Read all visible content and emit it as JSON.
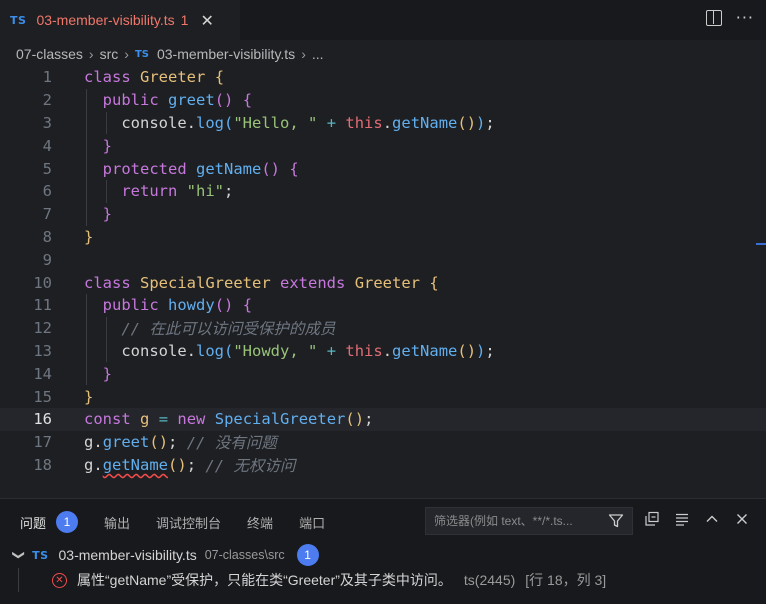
{
  "tab": {
    "lang": "TS",
    "title": "03-member-visibility.ts",
    "count": "1",
    "close": "✕"
  },
  "tab_actions": {
    "split_icon": "split-editor-icon",
    "more": "···"
  },
  "breadcrumb": {
    "folder": "07-classes",
    "sub": "src",
    "lang": "TS",
    "file": "03-member-visibility.ts",
    "ellipsis": "..."
  },
  "code_lines": [
    {
      "n": "1"
    },
    {
      "n": "2"
    },
    {
      "n": "3"
    },
    {
      "n": "4"
    },
    {
      "n": "5"
    },
    {
      "n": "6"
    },
    {
      "n": "7"
    },
    {
      "n": "8"
    },
    {
      "n": "9"
    },
    {
      "n": "10"
    },
    {
      "n": "11"
    },
    {
      "n": "12"
    },
    {
      "n": "13"
    },
    {
      "n": "14"
    },
    {
      "n": "15"
    },
    {
      "n": "16"
    },
    {
      "n": "17"
    },
    {
      "n": "18"
    }
  ],
  "code": {
    "l1": {
      "kw": "class",
      "name": "Greeter",
      "brace": "{"
    },
    "l2": {
      "kw": "public",
      "fn": "greet",
      "parens": "()",
      "brace": "{"
    },
    "l3": {
      "obj": "console",
      "dot": ".",
      "fn": "log",
      "open": "(",
      "str": "\"Hello, \"",
      "op": "+",
      "this": "this",
      "dot2": ".",
      "fn2": "getName",
      "call": "()",
      "close": ")",
      "semi": ";"
    },
    "l4": {
      "brace": "}"
    },
    "l5": {
      "kw": "protected",
      "fn": "getName",
      "parens": "()",
      "brace": "{"
    },
    "l6": {
      "kw": "return",
      "str": "\"hi\"",
      "semi": ";"
    },
    "l7": {
      "brace": "}"
    },
    "l8": {
      "brace": "}"
    },
    "l10": {
      "kw": "class",
      "name": "SpecialGreeter",
      "kw2": "extends",
      "base": "Greeter",
      "brace": "{"
    },
    "l11": {
      "kw": "public",
      "fn": "howdy",
      "parens": "()",
      "brace": "{"
    },
    "l12": {
      "comment": "// 在此可以访问受保护的成员"
    },
    "l13": {
      "obj": "console",
      "dot": ".",
      "fn": "log",
      "open": "(",
      "str": "\"Howdy, \"",
      "op": "+",
      "this": "this",
      "dot2": ".",
      "fn2": "getName",
      "call": "()",
      "close": ")",
      "semi": ";"
    },
    "l14": {
      "brace": "}"
    },
    "l15": {
      "brace": "}"
    },
    "l16": {
      "kw": "const",
      "var": "g",
      "eq": "=",
      "kw2": "new",
      "cls": "SpecialGreeter",
      "call": "()",
      "semi": ";"
    },
    "l17": {
      "obj": "g",
      "dot": ".",
      "fn": "greet",
      "call": "()",
      "semi": ";",
      "comment": "// 没有问题"
    },
    "l18": {
      "obj": "g",
      "dot": ".",
      "fn": "getName",
      "call": "()",
      "semi": ";",
      "comment": "// 无权访问"
    }
  },
  "panel": {
    "tabs": [
      "问题",
      "输出",
      "调试控制台",
      "终端",
      "端口"
    ],
    "problems_count": "1",
    "filter_placeholder": "筛选器(例如 text、**/*.ts..."
  },
  "problems": {
    "file_lang": "TS",
    "file": "03-member-visibility.ts",
    "path": "07-classes\\src",
    "count": "1",
    "message": "属性“getName”受保护，只能在类“Greeter”及其子类中访问。",
    "code": "ts(2445)",
    "location": "[行 18，列 3]"
  },
  "colors": {
    "error": "#f14c4c",
    "accent": "#4c7cf0",
    "tab_title": "#f0776a"
  }
}
